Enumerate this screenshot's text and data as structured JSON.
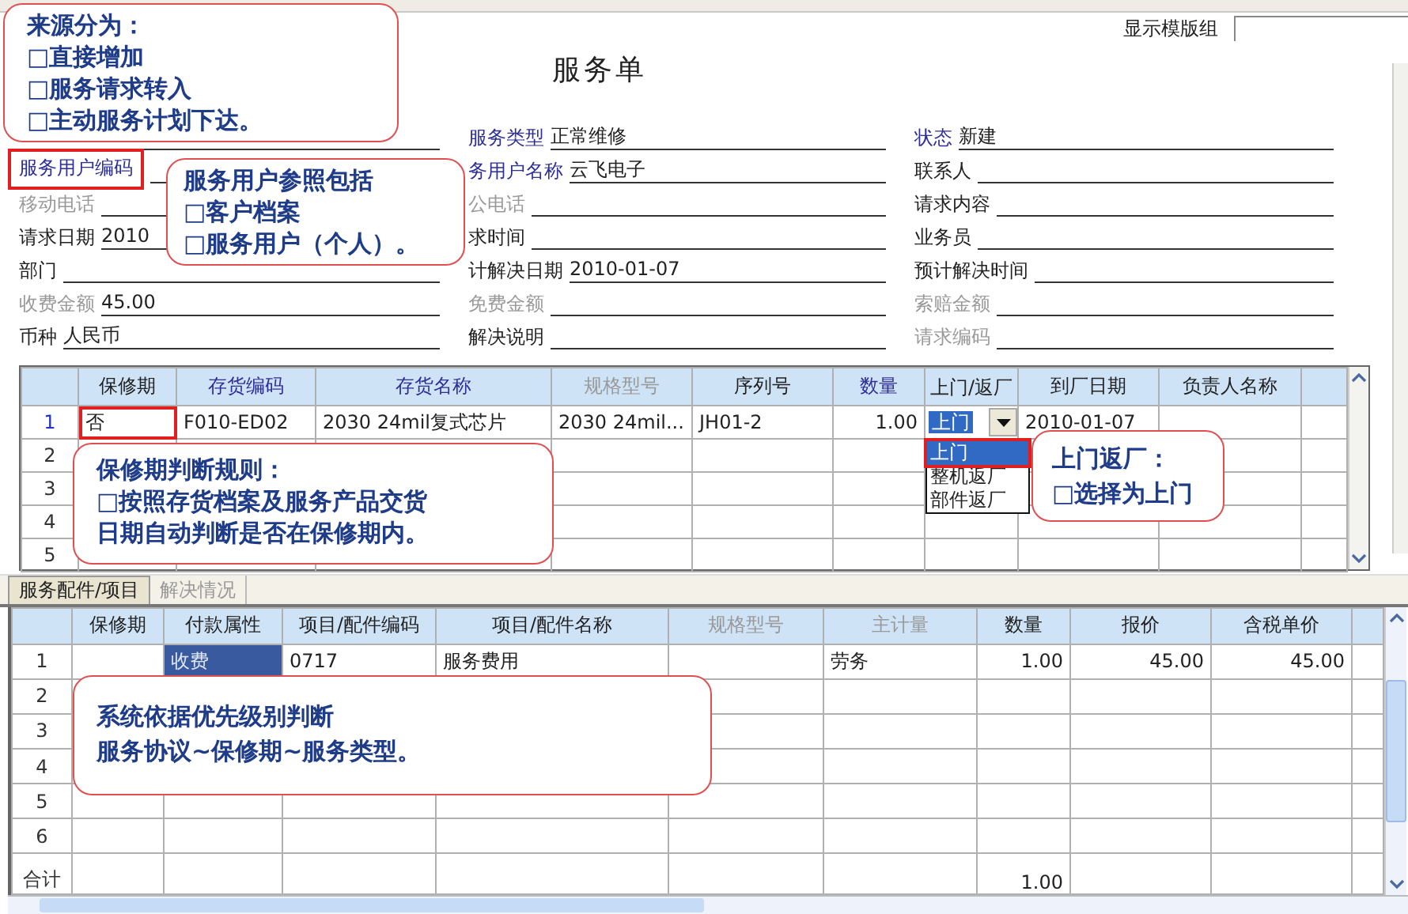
{
  "window": {
    "title": "服务单"
  },
  "template_group": {
    "label": "显示模版组"
  },
  "form": {
    "rows": [
      {
        "middle": {
          "label": "服务类型",
          "value": "正常维修",
          "kind": "required"
        },
        "right": {
          "label": "状态",
          "value": "新建",
          "kind": "required"
        }
      },
      {
        "left": {
          "label": "服务用户编码",
          "kind": "required",
          "highlighted": true
        },
        "middle": {
          "label": "务用户名称",
          "value": "云飞电子",
          "kind": "required"
        },
        "right": {
          "label": "联系人",
          "kind": "normal"
        }
      },
      {
        "left": {
          "label": "移动电话",
          "kind": "disabled"
        },
        "middle": {
          "label": "公电话",
          "kind": "disabled"
        },
        "right": {
          "label": "请求内容",
          "kind": "normal"
        }
      },
      {
        "left": {
          "label": "请求日期",
          "value": "2010",
          "kind": "normal"
        },
        "middle": {
          "label": "求时间",
          "kind": "normal"
        },
        "right": {
          "label": "业务员",
          "kind": "normal"
        }
      },
      {
        "left": {
          "label": "部门",
          "kind": "normal"
        },
        "middle": {
          "label": "计解决日期",
          "value": "2010-01-07",
          "kind": "normal"
        },
        "right": {
          "label": "预计解决时间",
          "kind": "normal"
        }
      },
      {
        "left": {
          "label": "收费金额",
          "value": "45.00",
          "kind": "disabled"
        },
        "middle": {
          "label": "免费金额",
          "kind": "disabled"
        },
        "right": {
          "label": "索赔金额",
          "kind": "disabled"
        }
      },
      {
        "left": {
          "label": "币种",
          "value": "人民币",
          "kind": "normal"
        },
        "middle": {
          "label": "解决说明",
          "kind": "normal"
        },
        "right": {
          "label": "请求编码",
          "kind": "disabled"
        }
      }
    ]
  },
  "items_table": {
    "columns": [
      {
        "label": "保修期",
        "kind": "normal"
      },
      {
        "label": "存货编码",
        "kind": "required"
      },
      {
        "label": "存货名称",
        "kind": "required"
      },
      {
        "label": "规格型号",
        "kind": "disabled"
      },
      {
        "label": "序列号",
        "kind": "normal"
      },
      {
        "label": "数量",
        "kind": "required",
        "numeric": true
      },
      {
        "label": "上门/返厂",
        "kind": "normal"
      },
      {
        "label": "到厂日期",
        "kind": "normal"
      },
      {
        "label": "负责人名称",
        "kind": "normal"
      }
    ],
    "rows": [
      {
        "number": "1",
        "current": true,
        "cells": [
          {
            "text": "否",
            "highlighted": true
          },
          "F010-ED02",
          "2030 24mil复式芯片",
          "2030 24mil...",
          "JH01-2",
          "1.00",
          {
            "kind": "dropdown",
            "value": "上门",
            "options": [
              {
                "label": "上门",
                "selected": true,
                "highlighted": true
              },
              {
                "label": "整机返厂",
                "selected": false
              },
              {
                "label": "部件返厂",
                "selected": false
              }
            ]
          },
          "2010-01-07",
          ""
        ]
      },
      {
        "number": "2",
        "current": false,
        "cells": []
      },
      {
        "number": "3",
        "current": false,
        "cells": []
      },
      {
        "number": "4",
        "current": false,
        "cells": []
      },
      {
        "number": "5",
        "current": false,
        "cells": []
      }
    ]
  },
  "tabs": [
    {
      "label": "服务配件/项目",
      "selected": true
    },
    {
      "label": "解决情况",
      "selected": false
    }
  ],
  "parts_table": {
    "columns": [
      {
        "label": "保修期",
        "kind": "normal"
      },
      {
        "label": "付款属性",
        "kind": "normal"
      },
      {
        "label": "项目/配件编码",
        "kind": "normal"
      },
      {
        "label": "项目/配件名称",
        "kind": "normal"
      },
      {
        "label": "规格型号",
        "kind": "disabled"
      },
      {
        "label": "主计量",
        "kind": "disabled"
      },
      {
        "label": "数量",
        "kind": "normal",
        "numeric": true
      },
      {
        "label": "报价",
        "kind": "normal",
        "numeric": true
      },
      {
        "label": "含税单价",
        "kind": "normal",
        "numeric": true
      }
    ],
    "rows": [
      {
        "number": "1",
        "cells": [
          "",
          {
            "text": "收费",
            "selected": true
          },
          "0717",
          "服务费用",
          "",
          "劳务",
          "1.00",
          "45.00",
          "45.00"
        ]
      },
      {
        "number": "2",
        "cells": []
      },
      {
        "number": "3",
        "cells": []
      },
      {
        "number": "4",
        "cells": []
      },
      {
        "number": "5",
        "cells": []
      },
      {
        "number": "6",
        "cells": []
      }
    ],
    "total": {
      "label": "合计",
      "cells": [
        "",
        "",
        "",
        "",
        "",
        "",
        "1.00",
        "",
        ""
      ]
    }
  },
  "callouts": [
    {
      "lines": [
        "来源分为：",
        "□直接增加",
        "□服务请求转入",
        "□主动服务计划下达。"
      ]
    },
    {
      "lines": [
        "服务用户参照包括",
        "□客户档案",
        "□服务用户（个人）。"
      ]
    },
    {
      "lines": [
        "保修期判断规则：",
        "□按照存货档案及服务产品交货",
        "日期自动判断是否在保修期内。"
      ]
    },
    {
      "lines": [
        "上门返厂：",
        "□选择为上门"
      ]
    },
    {
      "lines": [
        "系统依据优先级别判断",
        "服务协议~保修期~服务类型。"
      ]
    }
  ]
}
